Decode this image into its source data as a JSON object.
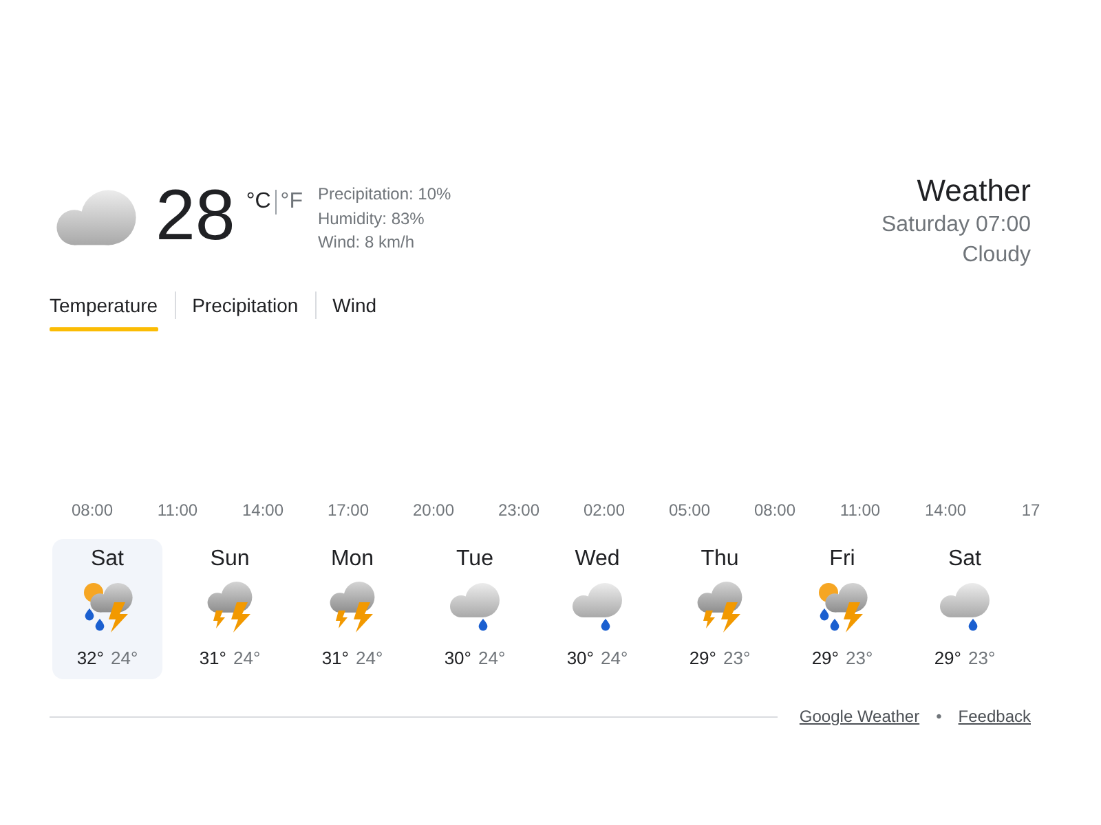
{
  "current": {
    "kind": "cloud",
    "temperature": "28",
    "units": [
      {
        "label": "°C",
        "selected": true
      },
      {
        "label": "°F",
        "selected": false
      }
    ],
    "details": [
      "Precipitation: 10%",
      "Humidity: 83%",
      "Wind: 8 km/h"
    ]
  },
  "header": {
    "title": "Weather",
    "datetime": "Saturday 07:00",
    "condition": "Cloudy"
  },
  "tabs": [
    {
      "label": "Temperature",
      "selected": true
    },
    {
      "label": "Precipitation",
      "selected": false
    },
    {
      "label": "Wind",
      "selected": false
    }
  ],
  "hours": [
    "08:00",
    "11:00",
    "14:00",
    "17:00",
    "20:00",
    "23:00",
    "02:00",
    "05:00",
    "08:00",
    "11:00",
    "14:00",
    "17"
  ],
  "days": [
    {
      "name": "Sat",
      "kind": "sun-thunder-rain",
      "high": "32°",
      "low": "24°",
      "selected": true
    },
    {
      "name": "Sun",
      "kind": "thunder",
      "high": "31°",
      "low": "24°",
      "selected": false
    },
    {
      "name": "Mon",
      "kind": "thunder",
      "high": "31°",
      "low": "24°",
      "selected": false
    },
    {
      "name": "Tue",
      "kind": "rain",
      "high": "30°",
      "low": "24°",
      "selected": false
    },
    {
      "name": "Wed",
      "kind": "rain",
      "high": "30°",
      "low": "24°",
      "selected": false
    },
    {
      "name": "Thu",
      "kind": "thunder",
      "high": "29°",
      "low": "23°",
      "selected": false
    },
    {
      "name": "Fri",
      "kind": "sun-thunder-rain",
      "high": "29°",
      "low": "23°",
      "selected": false
    },
    {
      "name": "Sat",
      "kind": "rain",
      "high": "29°",
      "low": "23°",
      "selected": false
    }
  ],
  "footer": {
    "links": [
      "Google Weather",
      "Feedback"
    ],
    "separator": "•"
  }
}
